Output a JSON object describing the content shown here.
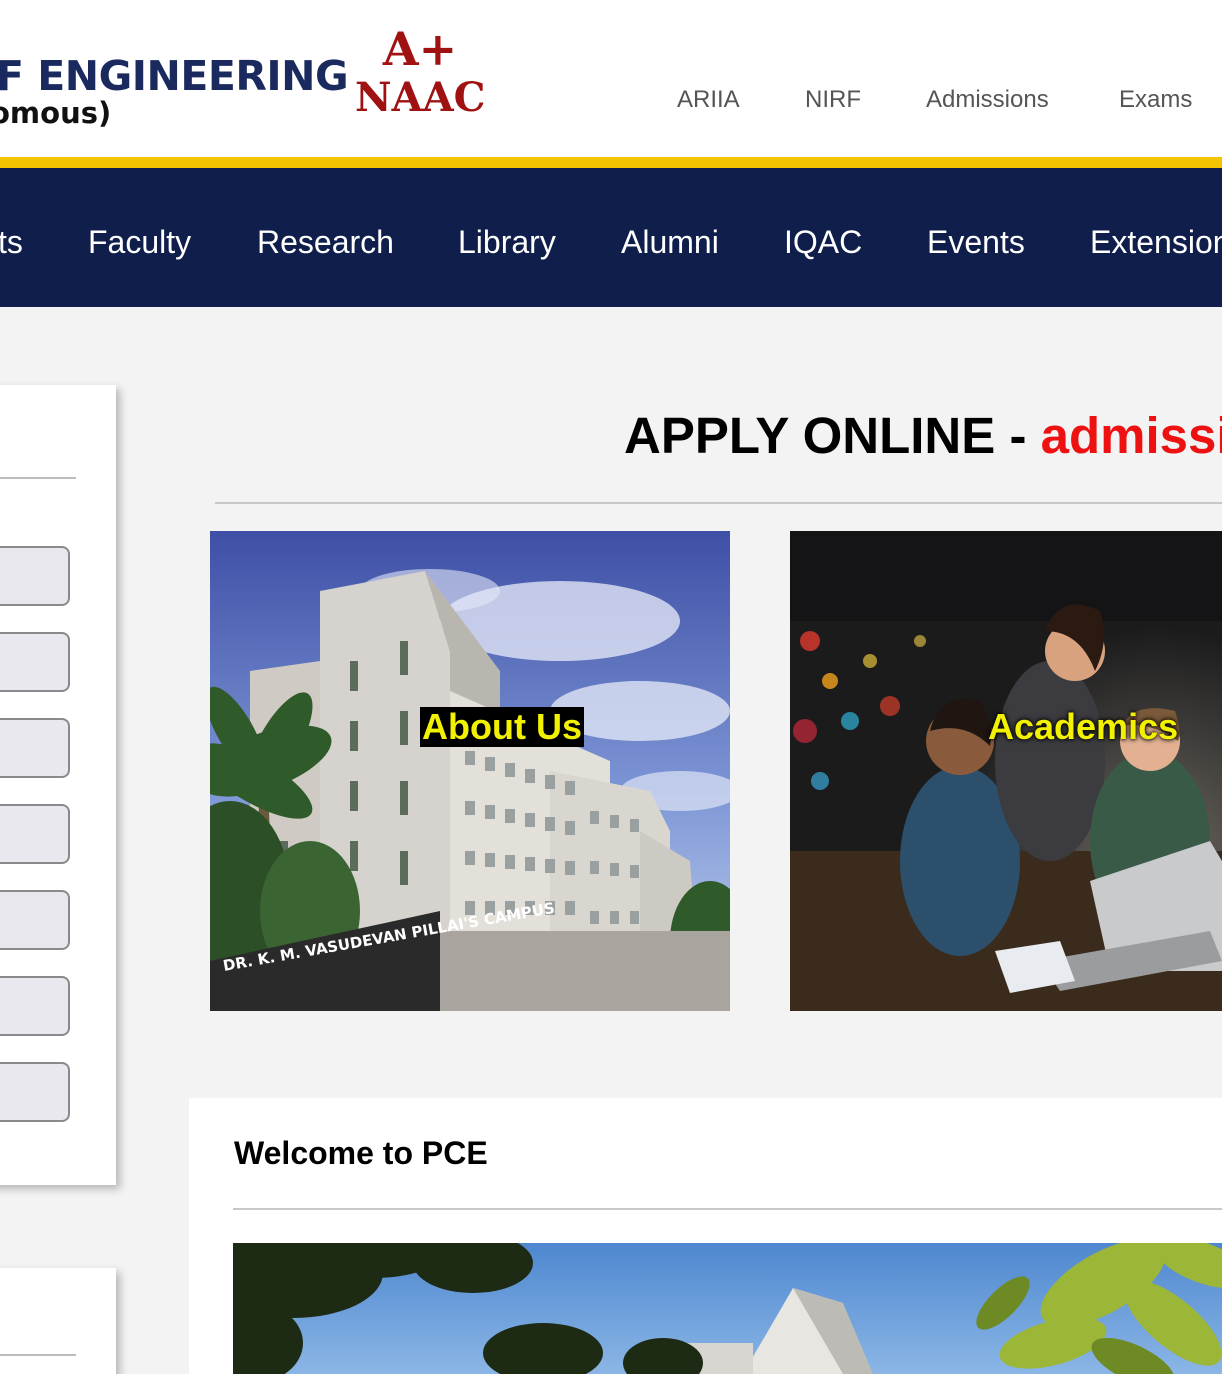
{
  "header": {
    "college_name": "F ENGINEERING",
    "college_sub": "omous)",
    "naac_grade": "A+",
    "naac_label": "NAAC",
    "top_links": [
      "ARIIA",
      "NIRF",
      "Admissions",
      "Exams"
    ]
  },
  "nav": {
    "items": [
      "ts",
      "Faculty",
      "Research",
      "Library",
      "Alumni",
      "IQAC",
      "Events",
      "Extension"
    ]
  },
  "apply": {
    "prefix": "APPLY ONLINE - ",
    "highlight": "admissio"
  },
  "cards": {
    "about_label": "About Us",
    "about_sign": "DR. K. M. VASUDEVAN PILLAI'S CAMPUS",
    "academics_label": "Academics"
  },
  "welcome": {
    "title": "Welcome to PCE"
  },
  "colors": {
    "navy": "#0f1e4a",
    "gold": "#f5c400",
    "naac_red": "#a01212",
    "highlight_red": "#ee1111",
    "label_yellow": "#f2f200"
  }
}
